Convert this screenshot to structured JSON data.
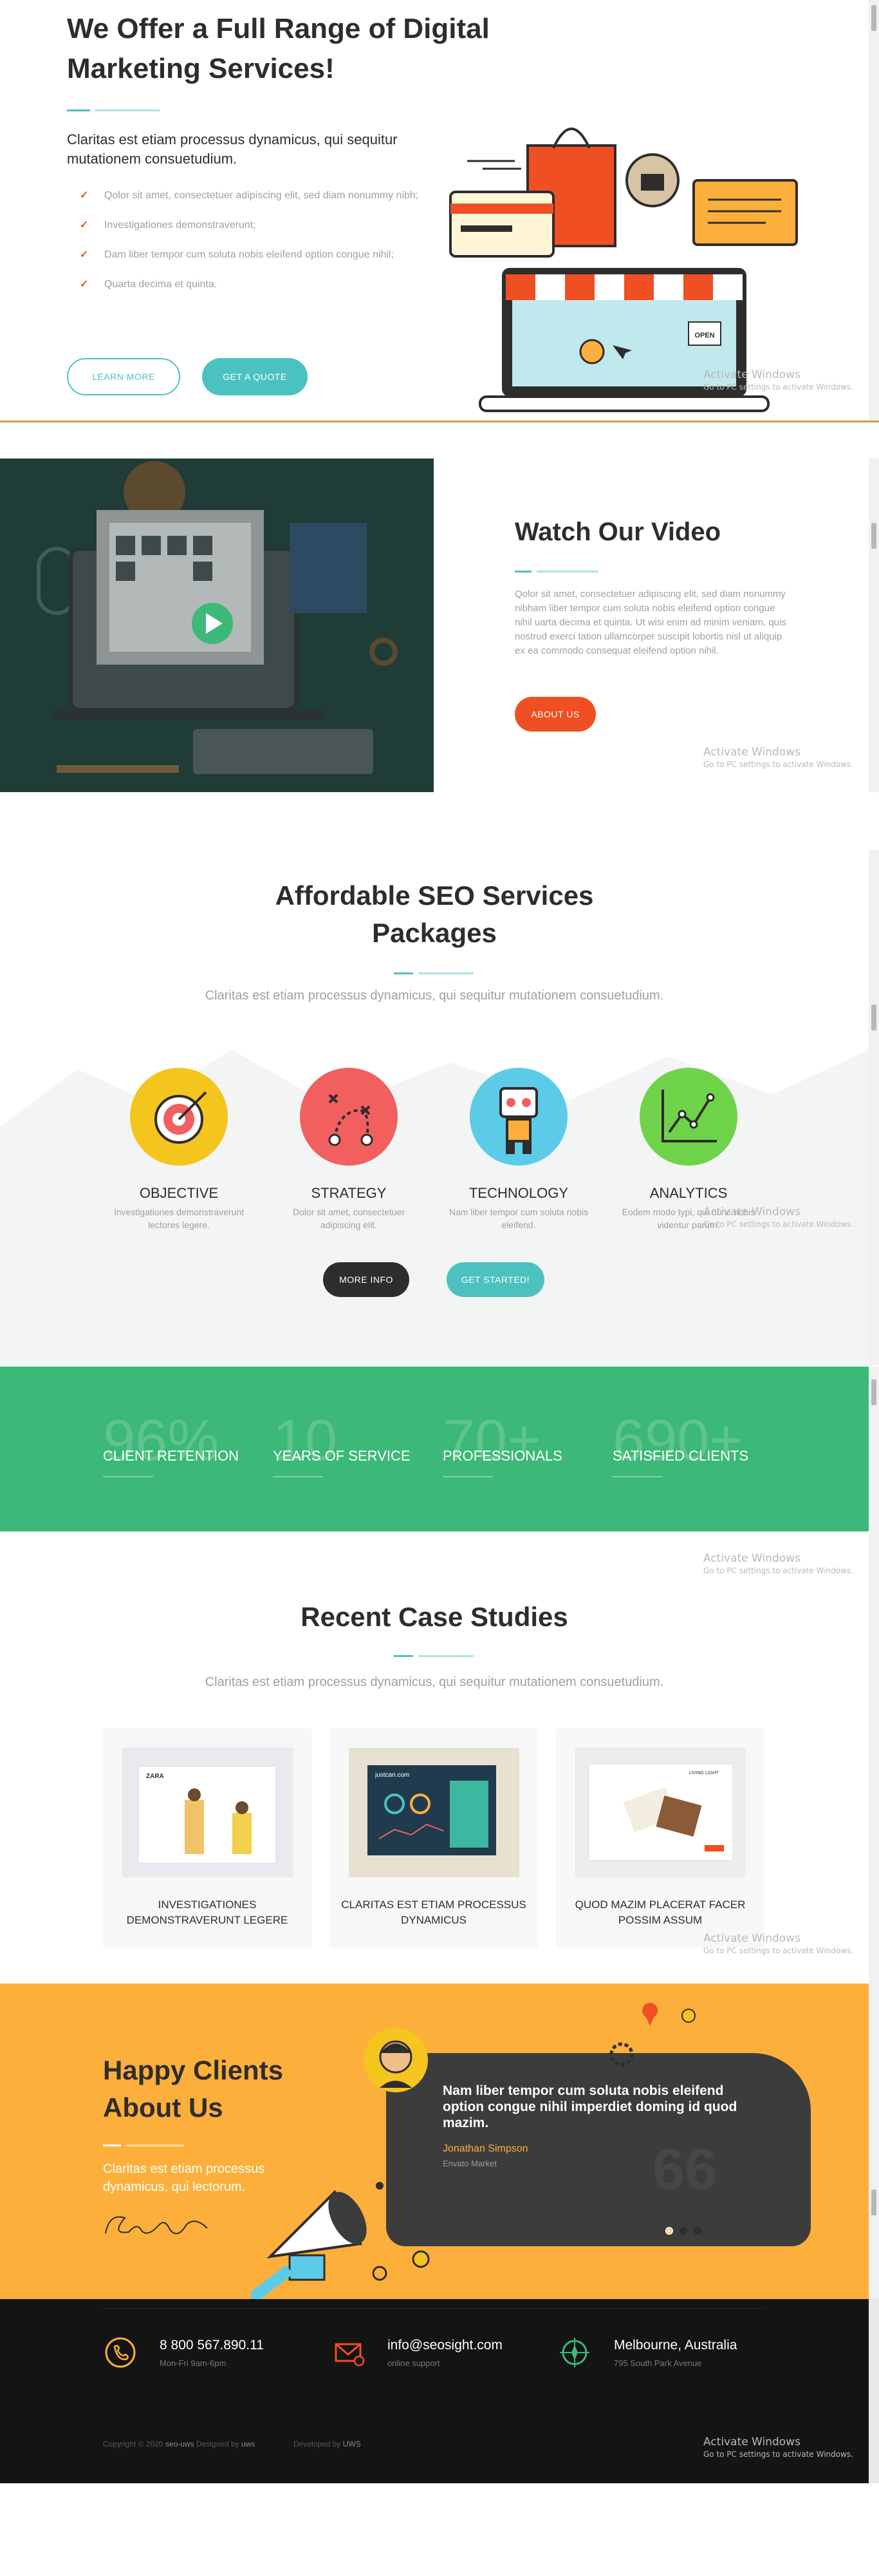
{
  "services": {
    "title": "We Offer a Full Range of Digital Marketing Services!",
    "subtitle": "Claritas est etiam processus dynamicus, qui sequitur mutationem consuetudium.",
    "items": [
      "Qolor sit amet, consectetuer adipiscing elit, sed diam nonummy nibh;",
      "Investigationes demonstraverunt;",
      "Dam liber tempor cum soluta nobis eleifend option congue nihil;",
      "Quarta decima et quinta."
    ],
    "learn_more": "Learn More",
    "get_quote": "Get a Quote",
    "shop_sign": "OPEN"
  },
  "video": {
    "title": "Watch Our Video",
    "text": "Qolor sit amet, consectetuer adipiscing elit, sed diam nonummy nibham liber tempor cum soluta nobis eleifend option congue nihil uarta decima et quinta. Ut wisi enim ad minim veniam, quis nostrud exerci tation ullamcorper suscipit lobortis nisl ut aliquip ex ea commodo consequat eleifend option nihil.",
    "about_us": "About Us"
  },
  "seo": {
    "title": "Affordable SEO Services Packages",
    "subtitle": "Claritas est etiam processus dynamicus, qui sequitur mutationem consuetudium.",
    "packages": [
      {
        "name": "Objective",
        "desc": "Investigationes demonstraverunt lectores legere.",
        "color": "#f4c51d"
      },
      {
        "name": "Strategy",
        "desc": "Dolor sit amet, consectetuer adipiscing elit.",
        "color": "#f15f5f"
      },
      {
        "name": "Technology",
        "desc": "Nam liber tempor cum soluta nobis eleifend.",
        "color": "#5ccbe8"
      },
      {
        "name": "Analytics",
        "desc": "Eodem modo typi, qui nunc nobis videntur parum.",
        "color": "#6fd34a"
      }
    ],
    "more_info": "More Info",
    "get_started": "Get Started!"
  },
  "stats": [
    {
      "num": "96%",
      "label": "Client Retention"
    },
    {
      "num": "10",
      "label": "Years of Service"
    },
    {
      "num": "70+",
      "label": "Professionals"
    },
    {
      "num": "690+",
      "label": "Satisfied Clients"
    }
  ],
  "cases": {
    "title": "Recent Case Studies",
    "subtitle": "Claritas est etiam processus dynamicus, qui sequitur mutationem consuetudium.",
    "items": [
      {
        "caption": "Investigationes demonstraverunt legere",
        "brand": "ZARA"
      },
      {
        "caption": "Claritas est etiam processus dynamicus",
        "brand": "justcan.com"
      },
      {
        "caption": "Quod mazim placerat facer possim assum",
        "brand": "LIVING LIGHT"
      }
    ]
  },
  "clients": {
    "title": "Happy Clients About Us",
    "subtitle": "Claritas est etiam processus dynamicus, qui lectorum.",
    "quote": "Nam liber tempor cum soluta nobis eleifend option congue nihil imperdiet doming id quod mazim.",
    "author": "Jonathan Simpson",
    "company": "Envato Market",
    "quote_mark": "66"
  },
  "footer": {
    "phone": "8 800 567.890.11",
    "phone_hours": "Mon-Fri 9am-6pm",
    "email": "info@seosight.com",
    "email_note": "online support",
    "city": "Melbourne, Australia",
    "address": "795 South Park Avenue",
    "copyright_prefix": "Copyright © 2020",
    "copyright_brand": "seo-uws",
    "designed_by": "Designed by",
    "designer": "uws",
    "developed_by": "Developed by",
    "developer": "UWS"
  },
  "watermark": {
    "title": "Activate Windows",
    "subtitle": "Go to PC settings to activate Windows."
  },
  "colors": {
    "teal": "#4cc2c0",
    "orange": "#f04e23",
    "green": "#3cb878",
    "yellow": "#fcb03b",
    "dark": "#2f2c2c",
    "footer": "#151414"
  }
}
